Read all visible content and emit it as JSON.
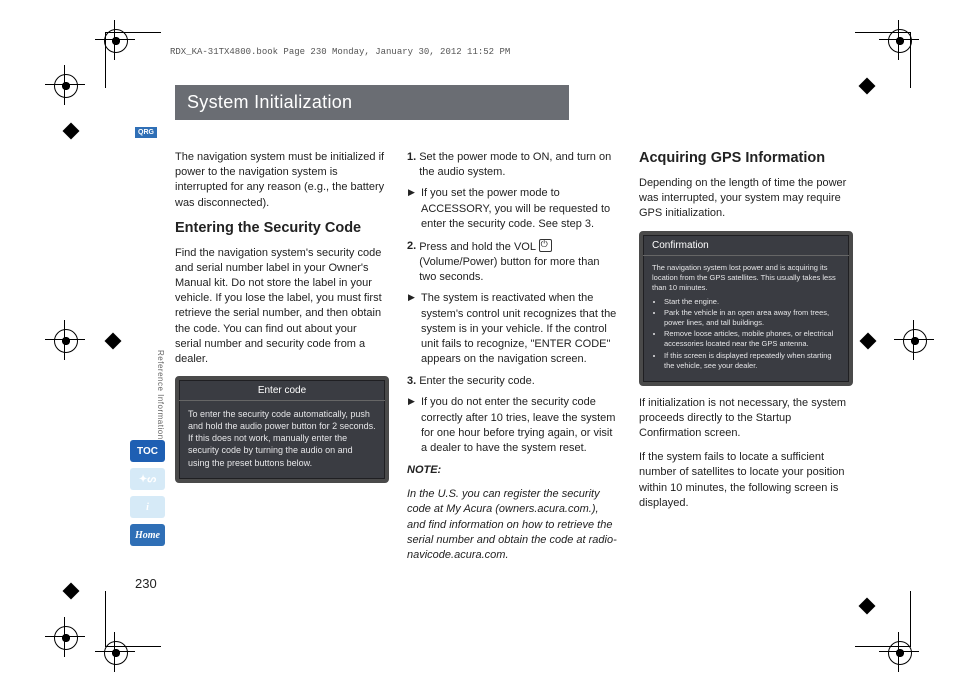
{
  "header_stamp": "RDX_KA-31TX4800.book  Page 230  Monday, January 30, 2012  11:52 PM",
  "title": "System Initialization",
  "qrg_label": "QRG",
  "side_label": "Reference Information",
  "page_number": "230",
  "icons": {
    "toc": "TOC",
    "home": "Home"
  },
  "col1": {
    "intro": "The navigation system must be initialized if power to the navigation system is interrupted for any reason (e.g., the battery was disconnected).",
    "heading": "Entering the Security Code",
    "para": "Find the navigation system's security code and serial number label in your Owner's Manual kit. Do not store the label in your vehicle. If you lose the label, you must first retrieve the serial number, and then obtain the code. You can find out about your serial number and security code from a dealer.",
    "screen_title": "Enter code",
    "screen_body": "To enter the security code automatically, push and hold the audio power button for 2 seconds. If this does not work, manually enter the security code by turning the audio on and using the preset buttons below."
  },
  "col2": {
    "step1": "Set the power mode to ON, and turn on the audio system.",
    "step1sub": "If you set the power mode to ACCESSORY, you will be requested to enter the security code. See step 3.",
    "step2a": "Press and hold the VOL ",
    "step2b": " (Volume/Power) button for more than two seconds.",
    "step2sub": "The system is reactivated when the system's control unit recognizes that the system is in your vehicle. If the control unit fails to recognize, \"ENTER CODE\" appears on the navigation screen.",
    "step3": "Enter the security code.",
    "step3sub": "If you do not enter the security code correctly after 10 tries, leave the system for one hour before trying again, or visit a dealer to have the system reset.",
    "note_label": "NOTE:",
    "note": "In the U.S. you can register the security code at My Acura (owners.acura.com.), and find information on how to retrieve the serial number and obtain the code at radio-navicode.acura.com."
  },
  "col3": {
    "heading": "Acquiring GPS Information",
    "intro": "Depending on the length of time the power was interrupted, your system may require GPS initialization.",
    "screen_title": "Confirmation",
    "screen_lead": "The navigation system lost power and is acquiring its location from the GPS satellites. This usually takes less than 10 minutes.",
    "bullets": [
      "Start the engine.",
      "Park the vehicle in an open area away from trees, power lines, and tall buildings.",
      "Remove loose articles, mobile phones, or electrical accessories located near the GPS antenna.",
      "If this screen is displayed repeatedly when starting the vehicle, see your dealer."
    ],
    "after1": "If initialization is not necessary, the system proceeds directly to the Startup Confirmation screen.",
    "after2": "If the system fails to locate a sufficient number of satellites to locate your position within 10 minutes, the following screen is displayed."
  }
}
